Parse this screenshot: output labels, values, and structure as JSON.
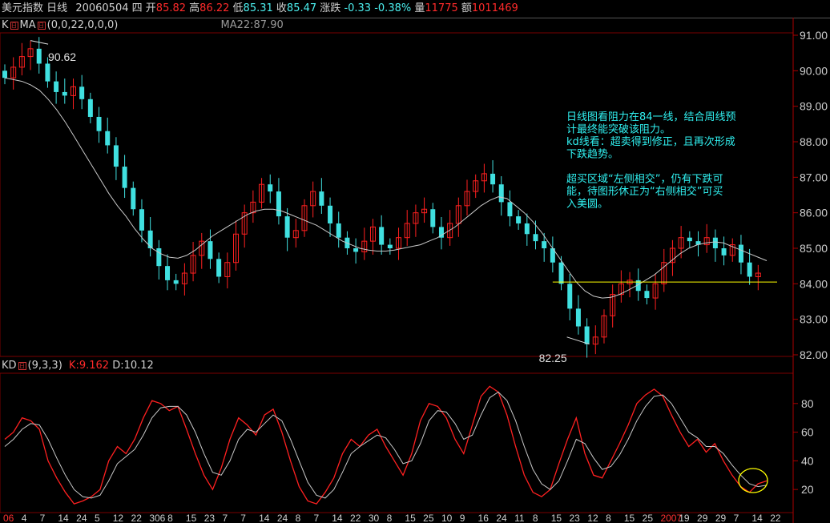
{
  "header": {
    "name": "美元指数",
    "period": "日线",
    "date": "20060504",
    "weekday": "四",
    "open_label": "开",
    "open": "85.82",
    "high_label": "高",
    "high": "86.22",
    "low_label": "低",
    "low": "85.31",
    "close_label": "收",
    "close": "85.47",
    "change_label": "涨跌",
    "change": "-0.33",
    "change_pct": "-0.38%",
    "volume_label": "量",
    "volume": "11775",
    "amount_label": "额",
    "amount": "1011469"
  },
  "main_panel": {
    "k_label": "K",
    "ma_label": "MA",
    "ma_params": "(0,0,22,0,0,0)",
    "ma22_readout": "MA22:87.90"
  },
  "kd_panel": {
    "label": "KD",
    "params": "(9,3,3)",
    "k_readout": "K:9.162",
    "d_readout": "D:10.12"
  },
  "annotation": {
    "lines": [
      "日线图看阻力在84一线，结合周线预",
      "计最终能突破该阻力。",
      "kd线看：超卖得到修正，且再次形成",
      "下跌趋势。",
      "",
      "超买区域“左侧相交”，仍有下跌可",
      "能，待图形休正为“右侧相交”可买",
      "入美圆。"
    ]
  },
  "colors": {
    "up": "#ff2020",
    "down": "#40e0e0",
    "ma": "#c8c8c8",
    "k": "#ff2020",
    "d": "#c8c8c8",
    "support": "#ffff00"
  },
  "chart_data": [
    {
      "type": "candlestick",
      "y_ticks": [
        "91.00",
        "90.00",
        "89.00",
        "88.00",
        "87.00",
        "86.00",
        "85.00",
        "84.00",
        "83.00",
        "82.00"
      ],
      "ylim": [
        82.0,
        91.0
      ],
      "x_tick_labels": [
        "06",
        "4",
        "7",
        "14",
        "24",
        "5",
        "12",
        "22",
        "306",
        "8",
        "15",
        "23",
        "7",
        "7",
        "14",
        "24",
        "8",
        "7",
        "14",
        "22",
        "30",
        "8",
        "15",
        "25",
        "10",
        "9",
        "16",
        "24",
        "11",
        "8",
        "15",
        "23",
        "12",
        "8",
        "15",
        "25",
        "2007",
        "19",
        "29",
        "29",
        "7",
        "14",
        "22"
      ],
      "peak_label": "90.62",
      "trough_label": "82.25",
      "support_level": 84.05,
      "ma_series": {
        "name": "MA22",
        "values": [
          89.8,
          89.75,
          89.7,
          89.6,
          89.45,
          89.2,
          88.9,
          88.55,
          88.15,
          87.75,
          87.35,
          86.95,
          86.55,
          86.2,
          85.9,
          85.55,
          85.25,
          85.0,
          84.85,
          84.75,
          84.72,
          84.8,
          84.95,
          85.15,
          85.35,
          85.5,
          85.65,
          85.8,
          85.95,
          86.05,
          86.1,
          86.1,
          86.05,
          85.95,
          85.85,
          85.75,
          85.65,
          85.5,
          85.35,
          85.2,
          85.1,
          85.0,
          84.95,
          84.92,
          84.92,
          84.95,
          85.0,
          85.05,
          85.1,
          85.2,
          85.3,
          85.45,
          85.6,
          85.8,
          86.0,
          86.2,
          86.35,
          86.45,
          86.4,
          86.2,
          86.0,
          85.75,
          85.45,
          85.1,
          84.75,
          84.4,
          84.05,
          83.8,
          83.65,
          83.6,
          83.62,
          83.7,
          83.82,
          83.95,
          84.1,
          84.25,
          84.45,
          84.65,
          84.85,
          85.0,
          85.1,
          85.15,
          85.18,
          85.15,
          85.05,
          84.95,
          84.85,
          84.75,
          84.65
        ]
      },
      "close_series": {
        "name": "",
        "values": [
          89.8,
          90.1,
          90.4,
          90.62,
          90.2,
          89.7,
          89.4,
          89.3,
          89.55,
          89.2,
          88.7,
          88.3,
          87.9,
          87.3,
          86.7,
          86.1,
          85.5,
          85.0,
          84.5,
          84.1,
          84.0,
          84.3,
          84.8,
          85.2,
          84.7,
          84.2,
          84.6,
          85.4,
          86.0,
          86.3,
          86.8,
          86.6,
          85.9,
          85.3,
          85.5,
          86.2,
          86.6,
          86.2,
          85.7,
          85.3,
          85.0,
          84.9,
          85.2,
          85.6,
          85.1,
          85.0,
          85.3,
          85.7,
          86.0,
          86.1,
          85.6,
          85.3,
          85.7,
          86.2,
          86.6,
          86.9,
          87.1,
          86.8,
          86.3,
          85.9,
          85.7,
          85.4,
          85.2,
          85.0,
          84.6,
          84.0,
          83.3,
          82.8,
          82.3,
          82.5,
          83.1,
          83.7,
          84.0,
          84.1,
          83.8,
          83.6,
          84.0,
          84.6,
          85.0,
          85.3,
          85.2,
          85.1,
          85.3,
          85.0,
          84.8,
          85.1,
          84.6,
          84.2,
          84.3
        ]
      }
    },
    {
      "type": "line",
      "y_ticks": [
        "80",
        "60",
        "40",
        "20"
      ],
      "ylim": [
        5,
        100
      ],
      "series": [
        {
          "name": "K",
          "values": [
            55,
            60,
            70,
            68,
            62,
            40,
            28,
            18,
            10,
            12,
            15,
            20,
            40,
            50,
            45,
            55,
            70,
            82,
            80,
            75,
            78,
            62,
            45,
            30,
            20,
            35,
            55,
            70,
            65,
            58,
            72,
            76,
            60,
            40,
            22,
            12,
            10,
            18,
            28,
            45,
            55,
            50,
            58,
            62,
            50,
            40,
            30,
            45,
            68,
            80,
            78,
            70,
            55,
            45,
            65,
            85,
            92,
            88,
            72,
            50,
            30,
            18,
            15,
            20,
            38,
            55,
            70,
            45,
            30,
            28,
            40,
            52,
            65,
            80,
            86,
            90,
            85,
            72,
            60,
            50,
            55,
            46,
            52,
            40,
            30,
            22,
            18,
            24,
            26
          ]
        },
        {
          "name": "D",
          "values": [
            50,
            55,
            62,
            66,
            65,
            55,
            42,
            30,
            20,
            15,
            14,
            16,
            26,
            38,
            43,
            48,
            58,
            70,
            77,
            78,
            78,
            72,
            60,
            45,
            32,
            30,
            40,
            55,
            62,
            60,
            66,
            72,
            68,
            55,
            40,
            25,
            16,
            14,
            20,
            32,
            45,
            50,
            54,
            58,
            56,
            48,
            38,
            40,
            52,
            68,
            75,
            74,
            66,
            55,
            58,
            72,
            84,
            88,
            82,
            68,
            50,
            34,
            24,
            20,
            26,
            40,
            55,
            52,
            42,
            34,
            36,
            44,
            55,
            68,
            78,
            85,
            86,
            80,
            70,
            60,
            56,
            50,
            50,
            45,
            37,
            30,
            24,
            22,
            23
          ]
        }
      ]
    }
  ]
}
